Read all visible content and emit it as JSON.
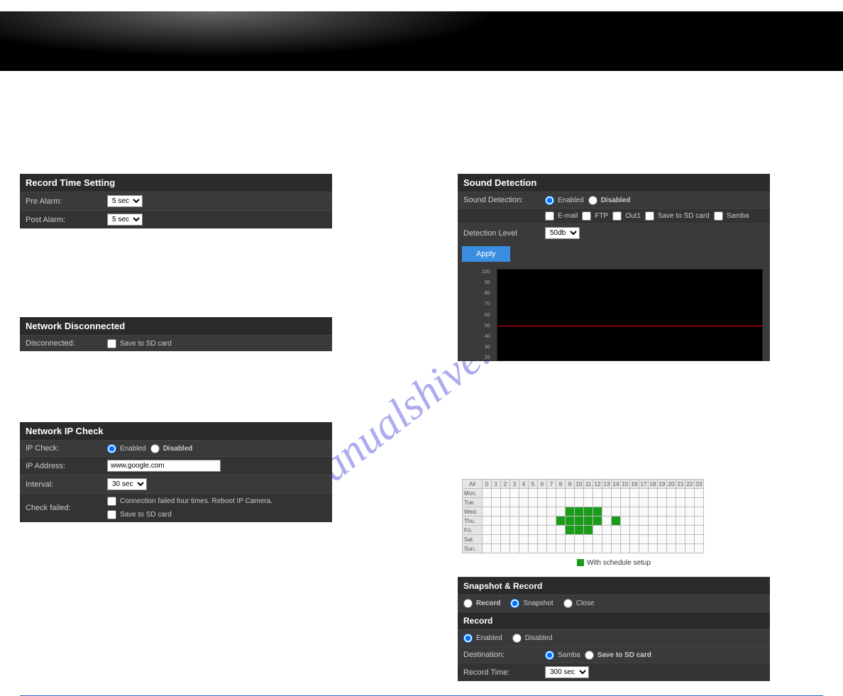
{
  "record_time": {
    "title": "Record Time Setting",
    "pre_label": "Pre Alarm:",
    "pre_value": "5 sec",
    "post_label": "Post Alarm:",
    "post_value": "5 sec"
  },
  "net_disc": {
    "title": "Network Disconnected",
    "label": "Disconnected:",
    "save_sd": "Save to SD card"
  },
  "ip_check": {
    "title": "Network IP Check",
    "ipcheck_label": "IP Check:",
    "enabled": "Enabled",
    "disabled": "Disabled",
    "addr_label": "IP Address:",
    "addr_value": "www.google.com",
    "interval_label": "Interval:",
    "interval_value": "30 sec",
    "fail_label": "Check failed:",
    "fail_opt1": "Connection failed four times. Reboot IP Camera.",
    "fail_opt2": "Save to SD card"
  },
  "sound": {
    "title": "Sound Detection",
    "sd_label": "Sound Detection:",
    "enabled": "Enabled",
    "disabled": "Disabled",
    "action_label": "",
    "email": "E-mail",
    "ftp": "FTP",
    "out1": "Out1",
    "save_sd": "Save to SD card",
    "samba": "Samba",
    "level_label": "Detection Level",
    "level_value": "50db",
    "apply": "Apply",
    "ticks": [
      "100",
      "90",
      "80",
      "70",
      "60",
      "50",
      "40",
      "30",
      "20"
    ]
  },
  "schedule": {
    "hours": [
      "All",
      "0",
      "1",
      "2",
      "3",
      "4",
      "5",
      "6",
      "7",
      "8",
      "9",
      "10",
      "11",
      "12",
      "13",
      "14",
      "15",
      "16",
      "17",
      "18",
      "19",
      "20",
      "21",
      "22",
      "23"
    ],
    "days": [
      "Mon.",
      "Tue.",
      "Wed.",
      "Thu.",
      "Fri.",
      "Sat.",
      "Sun."
    ],
    "cells": {
      "Wed.": [
        9,
        10,
        11,
        12
      ],
      "Thu.": [
        8,
        9,
        10,
        11,
        12,
        14
      ],
      "Fri.": [
        9,
        10,
        11
      ]
    },
    "legend": "With schedule setup"
  },
  "snap": {
    "title": "Snapshot & Record",
    "o_record": "Record",
    "o_snapshot": "Snapshot",
    "o_close": "Close",
    "rec_title": "Record",
    "enabled": "Enabled",
    "disabled": "Disabled",
    "dest_label": "Destination:",
    "samba": "Samba",
    "save_sd": "Save to SD card",
    "rt_label": "Record Time:",
    "rt_value": "300 sec"
  },
  "watermark": "manualshive.com"
}
